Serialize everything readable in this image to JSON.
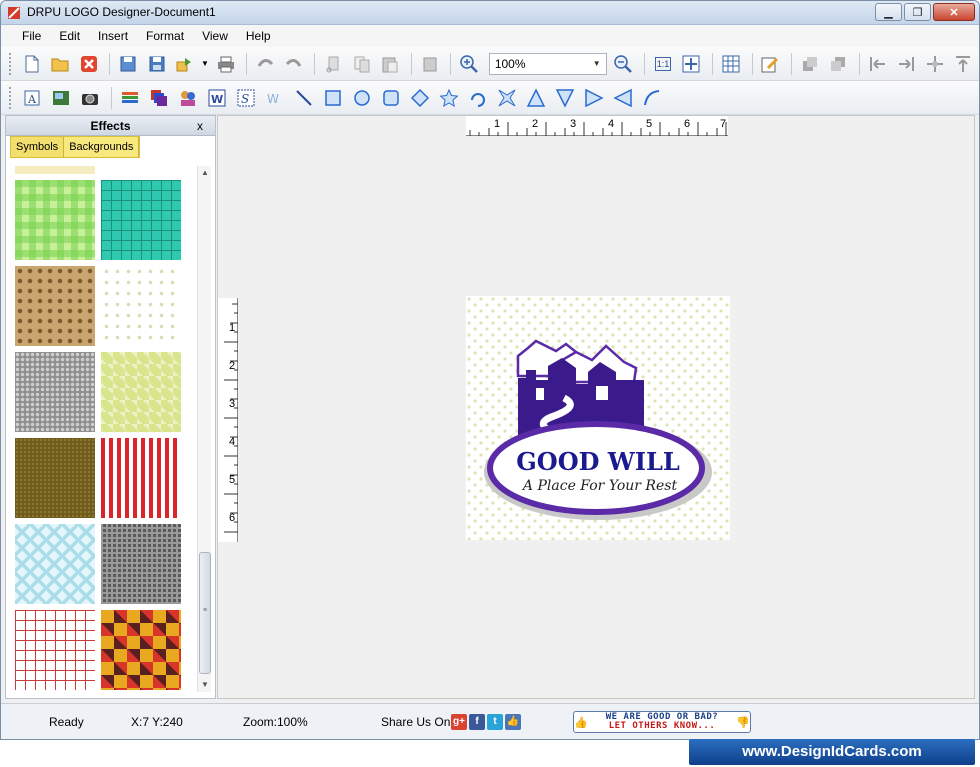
{
  "window": {
    "title": "DRPU LOGO Designer-Document1"
  },
  "menu": [
    "File",
    "Edit",
    "Insert",
    "Format",
    "View",
    "Help"
  ],
  "toolbar": {
    "zoom_value": "100%",
    "zoom_fit_label": "1:1"
  },
  "panel": {
    "title": "Effects",
    "close_label": "x",
    "tabs": [
      "Symbols",
      "Backgrounds"
    ],
    "active_tab": "Backgrounds"
  },
  "rulers": {
    "top": [
      "1",
      "2",
      "3",
      "4",
      "5",
      "6",
      "7"
    ],
    "left": [
      "1",
      "2",
      "3",
      "4",
      "5",
      "6"
    ]
  },
  "logo": {
    "title": "GOOD WILL",
    "subtitle": "A Place For Your Rest",
    "colors": {
      "primary": "#3b1a8c",
      "accent": "#5b2aa6",
      "dots": "#dfe3b3"
    }
  },
  "status": {
    "ready": "Ready",
    "coords": "X:7  Y:240",
    "zoom": "Zoom:100%",
    "share_label": "Share Us On:",
    "feedback_line1": "WE ARE GOOD OR BAD?",
    "feedback_line2": "LET OTHERS KNOW..."
  },
  "brand": "www.DesignIdCards.com"
}
